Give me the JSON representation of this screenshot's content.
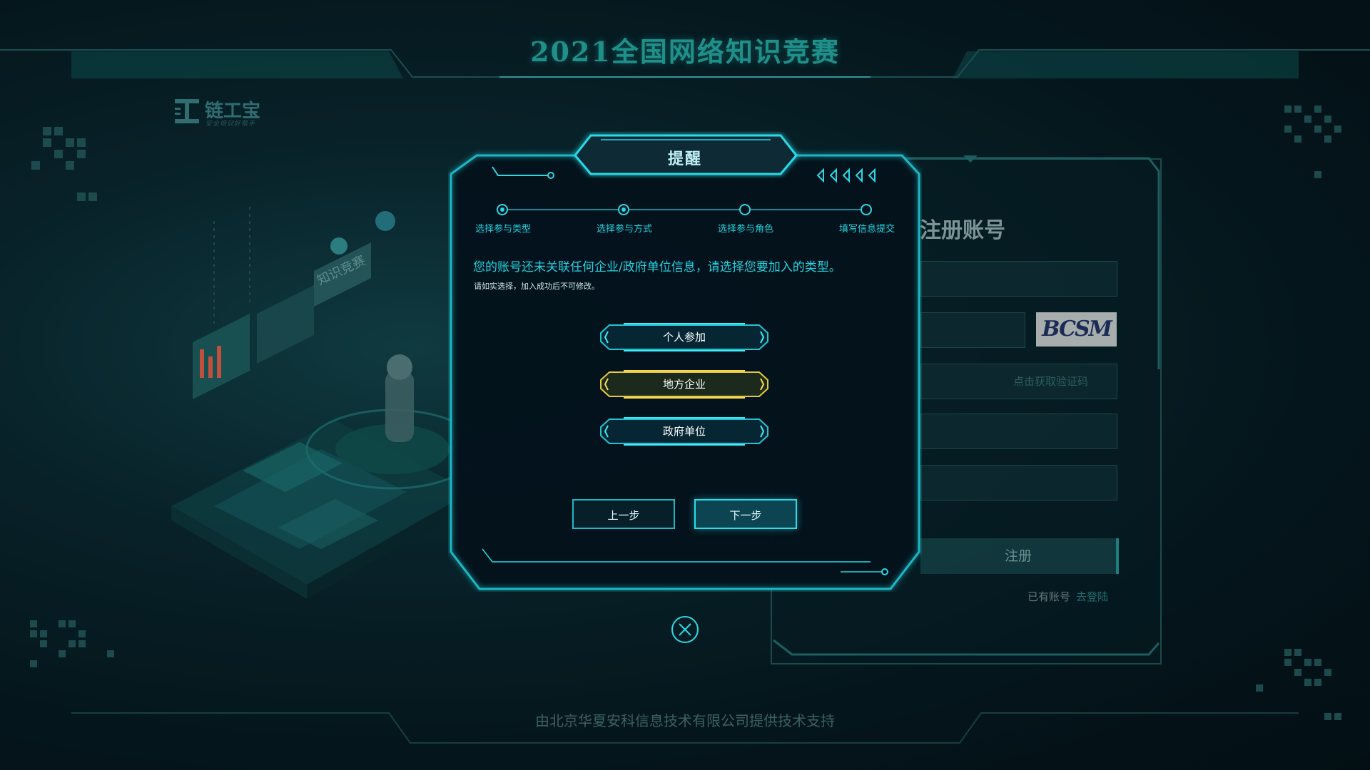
{
  "header": {
    "title": "2021全国网络知识竞赛"
  },
  "logo": {
    "name": "链工宝",
    "tagline": "安全培训好帮手"
  },
  "register_panel": {
    "title": "注册账号",
    "captcha_text": "BCSM",
    "sms_link": "点击获取验证码",
    "register_button": "注册",
    "has_account": "已有账号",
    "login_link": "去登陆"
  },
  "modal": {
    "title": "提醒",
    "steps": [
      "选择参与类型",
      "选择参与方式",
      "选择参与角色",
      "填写信息提交"
    ],
    "question": "您的账号还未关联任何企业/政府单位信息，请选择您要加入的类型。",
    "hint": "请如实选择，加入成功后不可修改。",
    "options": [
      "个人参加",
      "地方企业",
      "政府单位"
    ],
    "selected_option": "地方企业",
    "prev_button": "上一步",
    "next_button": "下一步",
    "close_icon": "close-circle-icon"
  },
  "footer": {
    "text": "由北京华夏安科信息技术有限公司提供技术支持"
  },
  "colors": {
    "accent": "#22d2e2",
    "selected": "#e8c840",
    "background": "#04151b"
  }
}
